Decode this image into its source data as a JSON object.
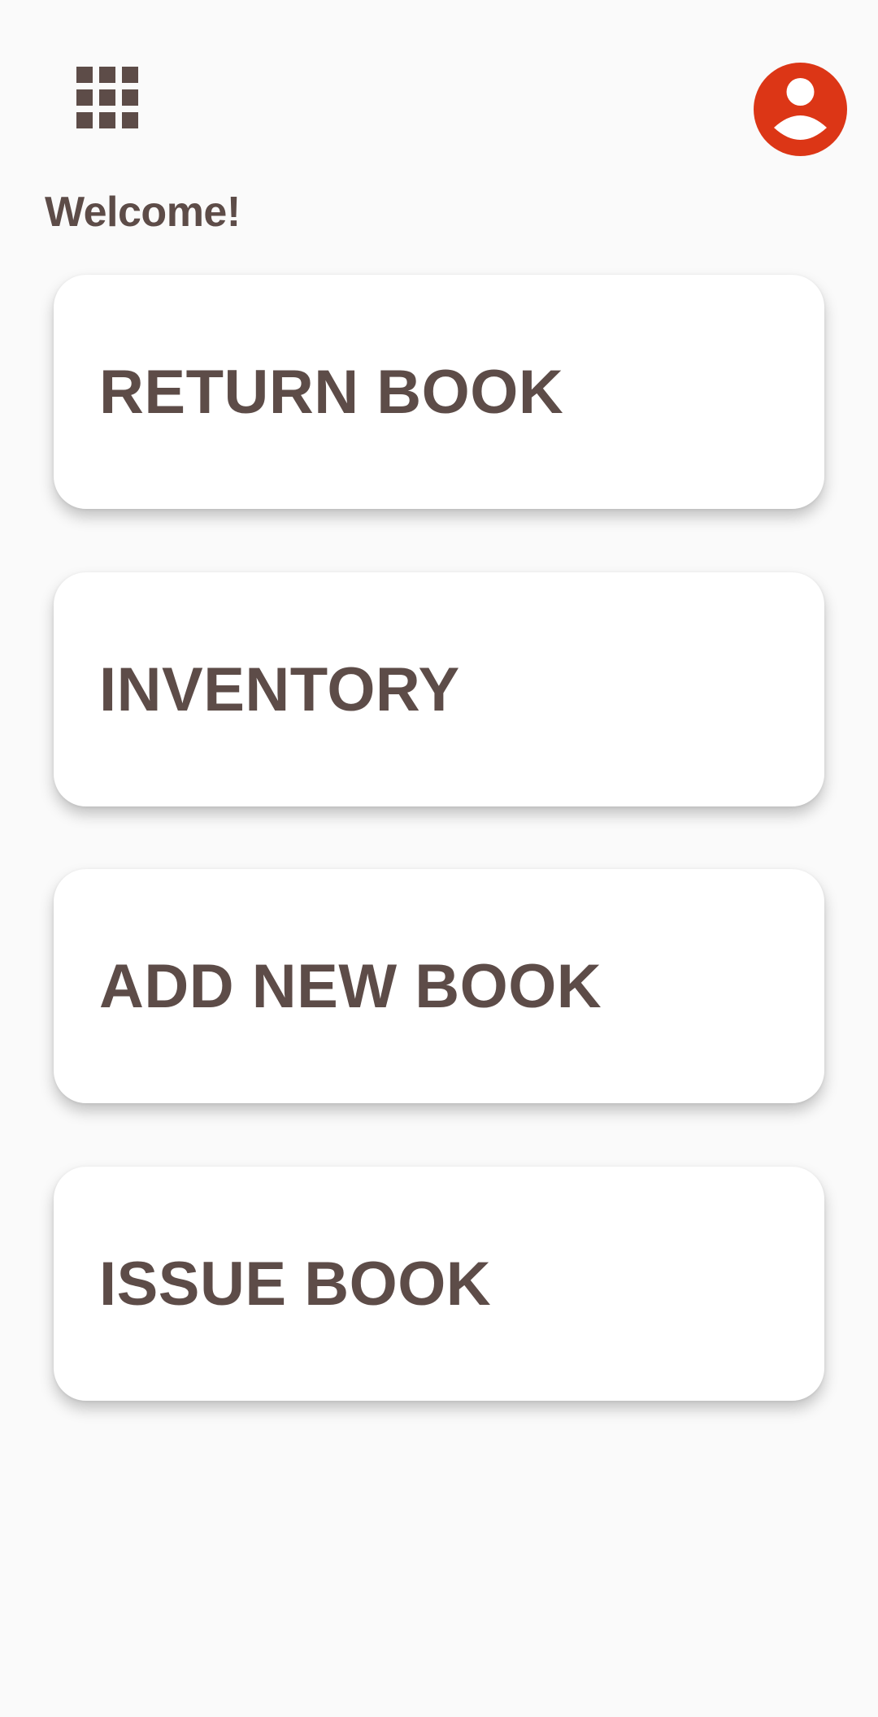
{
  "header": {
    "menu_icon": "grid-apps-icon",
    "profile_icon": "account-circle-icon",
    "welcome_text": "Welcome!"
  },
  "menu": {
    "items": [
      {
        "label": "RETURN BOOK"
      },
      {
        "label": "INVENTORY"
      },
      {
        "label": "ADD NEW BOOK"
      },
      {
        "label": "ISSUE BOOK"
      }
    ]
  },
  "colors": {
    "background": "#fafafa",
    "card": "#ffffff",
    "text": "#5d4c48",
    "accent": "#dc3616"
  }
}
